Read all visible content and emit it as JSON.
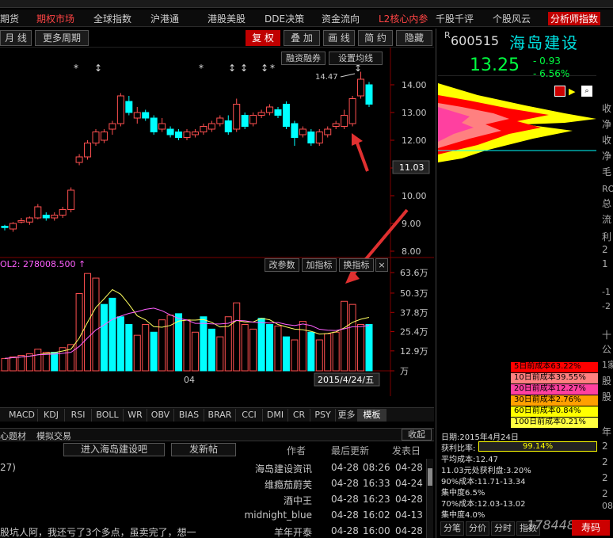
{
  "menu": {
    "items": [
      {
        "label": "期货",
        "cls": ""
      },
      {
        "label": "期权市场",
        "cls": "hot"
      },
      {
        "label": "全球指数",
        "cls": ""
      },
      {
        "label": "沪港通",
        "cls": ""
      },
      {
        "label": "港股美股",
        "cls": ""
      },
      {
        "label": "DDE决策",
        "cls": ""
      },
      {
        "label": "资金流向",
        "cls": ""
      },
      {
        "label": "L2核心内参",
        "cls": "hot"
      },
      {
        "label": "千股千评",
        "cls": ""
      },
      {
        "label": "个股风云",
        "cls": ""
      },
      {
        "label": "分析师指数",
        "cls": "hl"
      }
    ]
  },
  "toolbar": {
    "period": "月 线",
    "more_period": "更多周期",
    "fuquan": "复 权",
    "overlay": "叠 加",
    "draw": "画 线",
    "simple": "简 约",
    "hide": "隐藏"
  },
  "chart": {
    "margin_label": "融资融券",
    "ma_setting": "设置均线",
    "price_marker": "14.47",
    "current_price_tag": "11.03",
    "price_ticks": [
      "14.00",
      "13.00",
      "12.00",
      "11.00",
      "10.00",
      "9.00",
      "8.00"
    ],
    "vol_label": "OL2: 278008.500",
    "vol_buttons": {
      "params": "改参数",
      "add": "加指标",
      "switch": "换指标",
      "close": "×"
    },
    "vol_ticks": [
      "63.6万",
      "50.3万",
      "37.8万",
      "25.4万",
      "12.9万",
      "万"
    ],
    "date_tick": "04",
    "date_label": "2015/4/24/五"
  },
  "chart_data": {
    "type": "candlestick",
    "candles": [
      [
        8.85,
        8.9,
        8.75,
        8.95,
        0
      ],
      [
        8.8,
        9.0,
        8.7,
        9.05,
        1
      ],
      [
        9.05,
        9.1,
        9.0,
        9.2,
        1
      ],
      [
        9.05,
        9.2,
        8.95,
        9.25,
        1
      ],
      [
        9.2,
        9.6,
        9.15,
        9.7,
        1
      ],
      [
        9.3,
        9.2,
        9.1,
        9.4,
        0
      ],
      [
        9.2,
        9.3,
        9.1,
        9.4,
        1
      ],
      [
        9.3,
        9.5,
        9.2,
        9.6,
        1
      ],
      [
        9.5,
        10.2,
        9.4,
        10.3,
        1
      ],
      [
        11.2,
        11.4,
        11.1,
        11.5,
        1
      ],
      [
        11.4,
        11.9,
        11.3,
        12.0,
        1
      ],
      [
        11.9,
        12.3,
        11.8,
        12.4,
        1
      ],
      [
        12.0,
        12.3,
        11.9,
        12.4,
        1
      ],
      [
        12.4,
        12.6,
        12.2,
        12.7,
        1
      ],
      [
        12.6,
        13.6,
        12.5,
        13.7,
        1
      ],
      [
        13.4,
        13.0,
        12.9,
        13.6,
        0
      ],
      [
        12.8,
        13.0,
        12.6,
        13.2,
        1
      ],
      [
        13.0,
        12.8,
        12.7,
        13.1,
        0
      ],
      [
        12.8,
        12.3,
        12.2,
        12.9,
        0
      ],
      [
        12.4,
        12.6,
        12.3,
        12.8,
        1
      ],
      [
        12.4,
        12.2,
        12.1,
        12.5,
        0
      ],
      [
        12.3,
        12.1,
        12.0,
        12.4,
        0
      ],
      [
        12.1,
        12.3,
        12.0,
        12.4,
        1
      ],
      [
        12.2,
        12.3,
        12.1,
        12.4,
        1
      ],
      [
        12.3,
        12.5,
        12.2,
        12.6,
        1
      ],
      [
        12.4,
        12.6,
        12.3,
        12.7,
        1
      ],
      [
        12.6,
        12.8,
        12.5,
        12.9,
        1
      ],
      [
        12.7,
        12.3,
        12.2,
        12.9,
        0
      ],
      [
        12.4,
        13.3,
        12.3,
        13.5,
        1
      ],
      [
        12.9,
        12.5,
        12.4,
        13.0,
        0
      ],
      [
        12.6,
        12.9,
        12.5,
        13.0,
        1
      ],
      [
        12.9,
        13.0,
        12.8,
        13.1,
        1
      ],
      [
        13.0,
        13.2,
        12.9,
        13.3,
        1
      ],
      [
        13.1,
        12.9,
        12.8,
        13.2,
        0
      ],
      [
        13.3,
        12.5,
        12.4,
        13.4,
        0
      ],
      [
        12.6,
        12.1,
        11.8,
        12.7,
        0
      ],
      [
        12.2,
        12.4,
        12.1,
        12.5,
        1
      ],
      [
        12.3,
        11.9,
        11.8,
        12.4,
        0
      ],
      [
        11.9,
        12.3,
        11.8,
        12.4,
        1
      ],
      [
        12.2,
        12.4,
        12.1,
        12.5,
        1
      ],
      [
        12.5,
        12.6,
        12.4,
        12.7,
        1
      ],
      [
        12.5,
        12.9,
        12.4,
        13.1,
        1
      ],
      [
        12.6,
        13.5,
        12.5,
        13.6,
        1
      ],
      [
        13.6,
        14.2,
        13.5,
        14.47,
        1
      ],
      [
        14.0,
        13.3,
        13.2,
        14.1,
        0
      ]
    ],
    "volumes": [
      [
        8,
        0
      ],
      [
        9,
        0
      ],
      [
        10,
        0
      ],
      [
        11,
        0
      ],
      [
        14,
        0
      ],
      [
        12,
        0
      ],
      [
        12,
        1
      ],
      [
        15,
        0
      ],
      [
        17,
        0
      ],
      [
        50,
        0
      ],
      [
        63,
        0
      ],
      [
        60,
        0
      ],
      [
        43,
        1
      ],
      [
        47,
        1
      ],
      [
        35,
        1
      ],
      [
        30,
        1
      ],
      [
        23,
        0
      ],
      [
        30,
        0
      ],
      [
        25,
        1
      ],
      [
        33,
        0
      ],
      [
        36,
        0
      ],
      [
        37,
        1
      ],
      [
        33,
        0
      ],
      [
        25,
        0
      ],
      [
        35,
        1
      ],
      [
        27,
        1
      ],
      [
        22,
        0
      ],
      [
        35,
        0
      ],
      [
        44,
        0
      ],
      [
        30,
        0
      ],
      [
        27,
        0
      ],
      [
        34,
        1
      ],
      [
        30,
        1
      ],
      [
        29,
        0
      ],
      [
        22,
        1
      ],
      [
        20,
        0
      ],
      [
        32,
        0
      ],
      [
        25,
        1
      ],
      [
        20,
        0
      ],
      [
        24,
        0
      ],
      [
        25,
        0
      ],
      [
        45,
        0
      ],
      [
        43,
        0
      ],
      [
        30,
        0
      ],
      [
        30,
        1
      ]
    ]
  },
  "indicator_tabs": [
    "MACD",
    "KDJ",
    "RSI",
    "BOLL",
    "WR",
    "OBV",
    "BIAS",
    "BRAR",
    "CCI",
    "DMI",
    "CR",
    "PSY",
    "更多",
    "模板"
  ],
  "news": {
    "tabs": [
      "心题材",
      "模拟交易"
    ],
    "collapse": "收起",
    "enter_btn": "进入海岛建设吧",
    "post_btn": "发新帖",
    "headers": {
      "author": "作者",
      "last": "最后更新",
      "posted": "发表日"
    },
    "rows": [
      {
        "title": "27)",
        "author": "海岛建设资讯",
        "last_date": "04-28",
        "last_time": "08:26",
        "posted": "04-28"
      },
      {
        "title": "",
        "author": "维瘾茄蔚芙",
        "last_date": "04-28",
        "last_time": "16:33",
        "posted": "04-24"
      },
      {
        "title": "",
        "author": "酒中王",
        "last_date": "04-28",
        "last_time": "16:23",
        "posted": "04-28"
      },
      {
        "title": "",
        "author": "midnight_blue",
        "last_date": "04-28",
        "last_time": "16:02",
        "posted": "04-13"
      },
      {
        "title": "股坑人阿，我还亏了3个多点，虽卖完了，想一",
        "author": "羊年开泰",
        "last_date": "04-28",
        "last_time": "16:00",
        "posted": "04-28"
      }
    ]
  },
  "quote": {
    "r_mark": "R",
    "code": "600515",
    "name": "海岛建设",
    "price": "13.25",
    "change": "- 0.93",
    "pct": "- 6.56%"
  },
  "cost_rows": [
    {
      "label": "5日前成本63.22%",
      "color": "#ff0000"
    },
    {
      "label": "10日前成本39.55%",
      "color": "#ff8080"
    },
    {
      "label": "20日前成本12.27%",
      "color": "#ff40a0"
    },
    {
      "label": "30日前成本2.76%",
      "color": "#ffa000"
    },
    {
      "label": "60日前成本0.84%",
      "color": "#ffff00"
    },
    {
      "label": "100日前成本0.21%",
      "color": "#ffff40"
    }
  ],
  "stats": {
    "date": "日期:2015年4月24日",
    "profit_label": "获利比率:",
    "profit_value": "99.14%",
    "avg_cost": "平均成本:12.47",
    "at_price": "11.03元处获利盘:3.20%",
    "c90": "90%成本:11.71-13.34",
    "conc90": "集中度6.5%",
    "c70": "70%成本:12.03-13.02",
    "conc70": "集中度4.0%"
  },
  "right_edge": [
    "收",
    "净",
    "收",
    "净",
    "毛",
    "RO",
    "总",
    "流",
    "利",
    "2",
    "1",
    "-1",
    "-2",
    "十",
    "公",
    "1家",
    "股",
    "股",
    "年",
    "2",
    "2",
    "2",
    "2",
    "08"
  ],
  "bottom_tabs": [
    "分笔",
    "分价",
    "分时",
    "指数"
  ],
  "watermark": "178448.com",
  "ad_label": "寿码"
}
